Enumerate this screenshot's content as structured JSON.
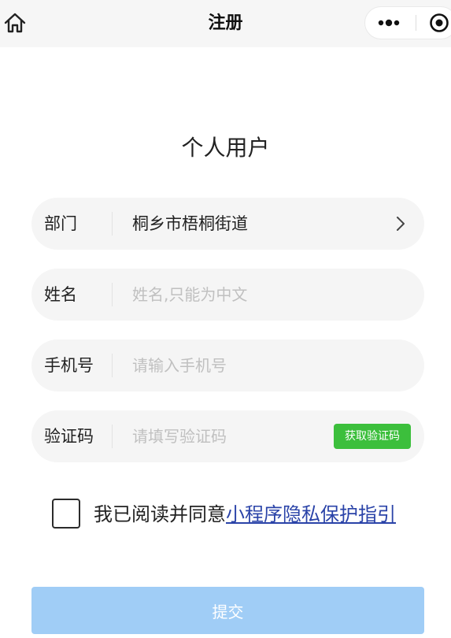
{
  "navbar": {
    "title": "注册",
    "home_icon": "home-icon",
    "more_icon": "more-dots-icon",
    "close_icon": "target-icon"
  },
  "page": {
    "title": "个人用户"
  },
  "form": {
    "department": {
      "label": "部门",
      "value": "桐乡市梧桐街道"
    },
    "name": {
      "label": "姓名",
      "placeholder": "姓名,只能为中文"
    },
    "phone": {
      "label": "手机号",
      "placeholder": "请输入手机号"
    },
    "code": {
      "label": "验证码",
      "placeholder": "请填写验证码",
      "button_label": "获取验证码"
    }
  },
  "agreement": {
    "text": "我已阅读并同意",
    "link_text": "小程序隐私保护指引",
    "checked": false
  },
  "submit": {
    "label": "提交"
  },
  "colors": {
    "accent_green": "#3cbf3c",
    "submit_blue": "#a0cdf6",
    "link_blue": "#2a43a8"
  }
}
